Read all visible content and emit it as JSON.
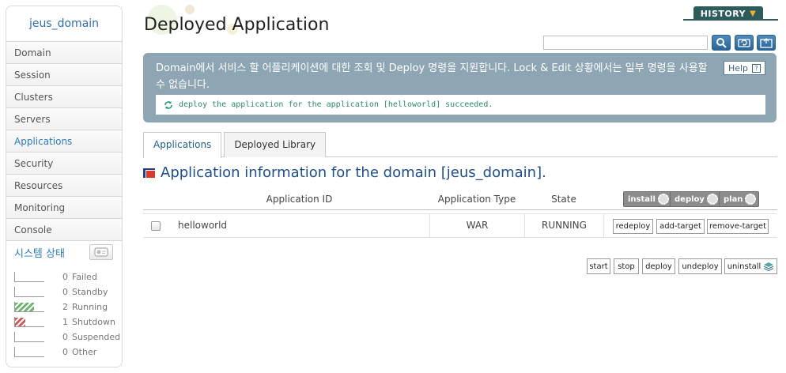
{
  "sidebar": {
    "domain": "jeus_domain",
    "items": [
      {
        "label": "Domain"
      },
      {
        "label": "Session"
      },
      {
        "label": "Clusters"
      },
      {
        "label": "Servers"
      },
      {
        "label": "Applications"
      },
      {
        "label": "Security"
      },
      {
        "label": "Resources"
      },
      {
        "label": "Monitoring"
      },
      {
        "label": "Console"
      }
    ],
    "active_item": "Applications",
    "system_status": {
      "title": "시스템 상태",
      "rows": [
        {
          "count": "0",
          "label": "Failed",
          "color": "#999999",
          "fraction": 0
        },
        {
          "count": "0",
          "label": "Standby",
          "color": "#999999",
          "fraction": 0
        },
        {
          "count": "2",
          "label": "Running",
          "color": "#6ab56a",
          "fraction": 0.66
        },
        {
          "count": "1",
          "label": "Shutdown",
          "color": "#c85a5a",
          "fraction": 0.34
        },
        {
          "count": "0",
          "label": "Suspended",
          "color": "#999999",
          "fraction": 0
        },
        {
          "count": "0",
          "label": "Other",
          "color": "#999999",
          "fraction": 0
        }
      ]
    }
  },
  "header": {
    "title": "Deployed Application",
    "history_label": "HISTORY",
    "search_value": ""
  },
  "info": {
    "description": "Domain에서 서비스 할 어플리케이션에 대한 조회 및 Deploy 명령을 지원합니다. Lock & Edit 상황에서는 일부 명령을 사용할 수 없습니다.",
    "help_label": "Help",
    "message": "deploy the application for the application [helloworld] succeeded."
  },
  "tabs": [
    {
      "label": "Applications"
    },
    {
      "label": "Deployed Library"
    }
  ],
  "section_title": "Application information for the domain [jeus_domain].",
  "table": {
    "columns": {
      "id": "Application ID",
      "type": "Application Type",
      "state": "State"
    },
    "header_buttons": {
      "install": "install",
      "deploy": "deploy",
      "plan": "plan"
    },
    "rows": [
      {
        "id": "helloworld",
        "type": "WAR",
        "state": "RUNNING",
        "actions": {
          "redeploy": "redeploy",
          "add_target": "add-target",
          "remove_target": "remove-target"
        }
      }
    ]
  },
  "footer_buttons": {
    "start": "start",
    "stop": "stop",
    "deploy": "deploy",
    "undeploy": "undeploy",
    "uninstall": "uninstall"
  },
  "colors": {
    "accent": "#2c7bc4",
    "info_panel": "#8ea5b4",
    "history": "#2e5b5b",
    "success_text": "#2b8a6b"
  }
}
